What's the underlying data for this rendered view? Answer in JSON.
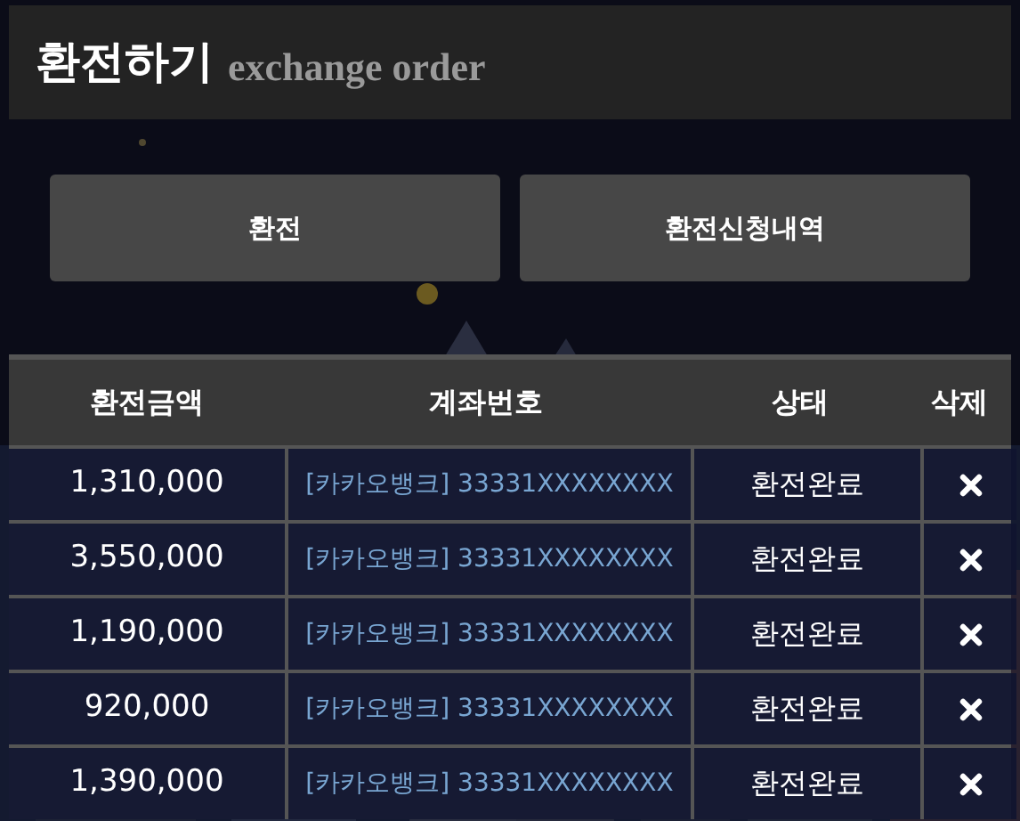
{
  "header": {
    "title": "환전하기",
    "subtitle": "exchange order"
  },
  "buttons": [
    {
      "label": "환전"
    },
    {
      "label": "환전신청내역"
    }
  ],
  "table": {
    "columns": [
      "환전금액",
      "계좌번호",
      "상태",
      "삭제"
    ],
    "rows": [
      {
        "amount": "1,310,000",
        "account": "[카카오뱅크] 33331XXXXXXXX",
        "status": "환전완료"
      },
      {
        "amount": "3,550,000",
        "account": "[카카오뱅크] 33331XXXXXXXX",
        "status": "환전완료"
      },
      {
        "amount": "1,190,000",
        "account": "[카카오뱅크] 33331XXXXXXXX",
        "status": "환전완료"
      },
      {
        "amount": "920,000",
        "account": "[카카오뱅크] 33331XXXXXXXX",
        "status": "환전완료"
      },
      {
        "amount": "1,390,000",
        "account": "[카카오뱅크] 33331XXXXXXXX",
        "status": "환전완료"
      }
    ]
  }
}
